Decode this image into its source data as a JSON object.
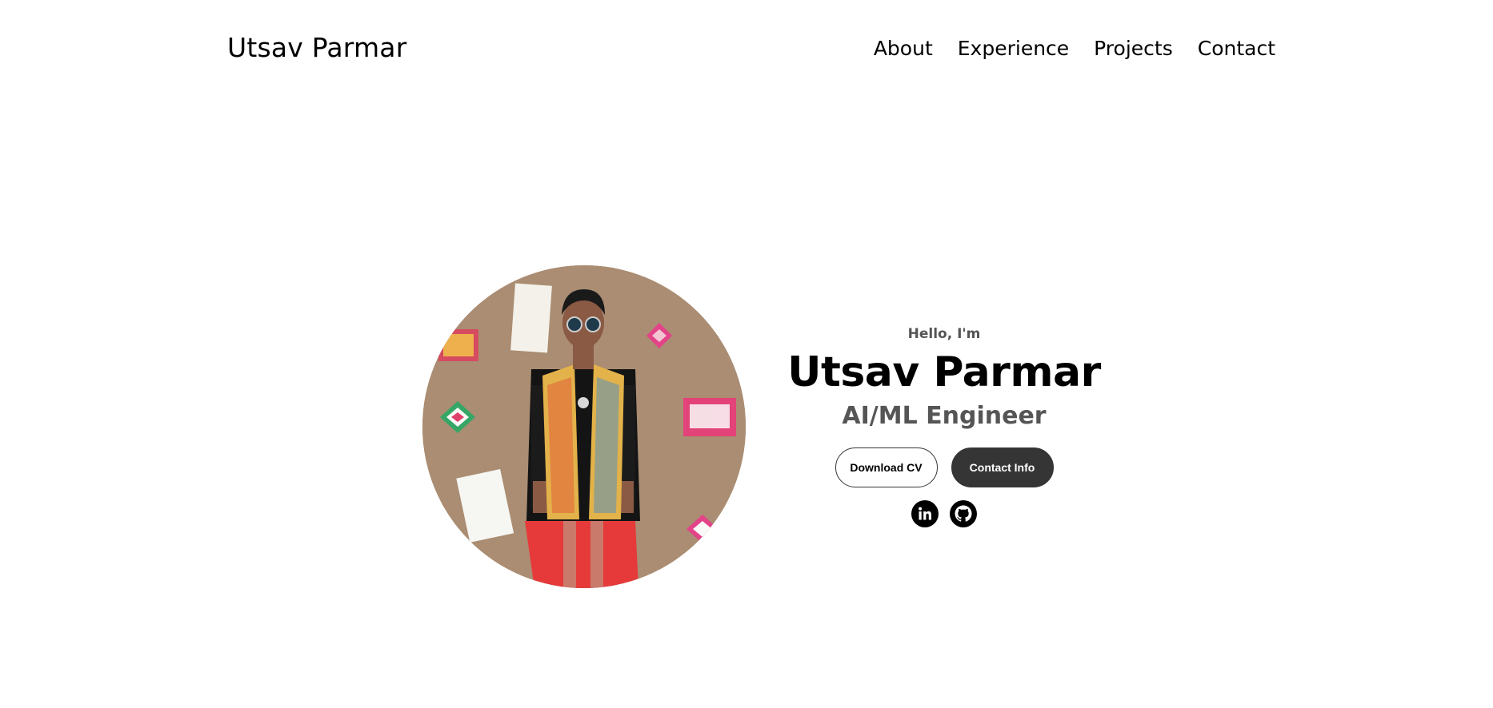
{
  "header": {
    "logo_text": "Utsav Parmar",
    "nav": [
      {
        "label": "About"
      },
      {
        "label": "Experience"
      },
      {
        "label": "Projects"
      },
      {
        "label": "Contact"
      }
    ]
  },
  "hero": {
    "greeting": "Hello, I'm",
    "name": "Utsav Parmar",
    "role": "AI/ML Engineer",
    "buttons": {
      "download_cv": "Download CV",
      "contact_info": "Contact Info"
    },
    "socials": [
      {
        "icon": "linkedin-icon"
      },
      {
        "icon": "github-icon"
      }
    ],
    "photo_alt": "profile picture"
  },
  "colors": {
    "text": "#000000",
    "muted": "#555555",
    "button_dark": "#353535",
    "background": "#ffffff"
  }
}
